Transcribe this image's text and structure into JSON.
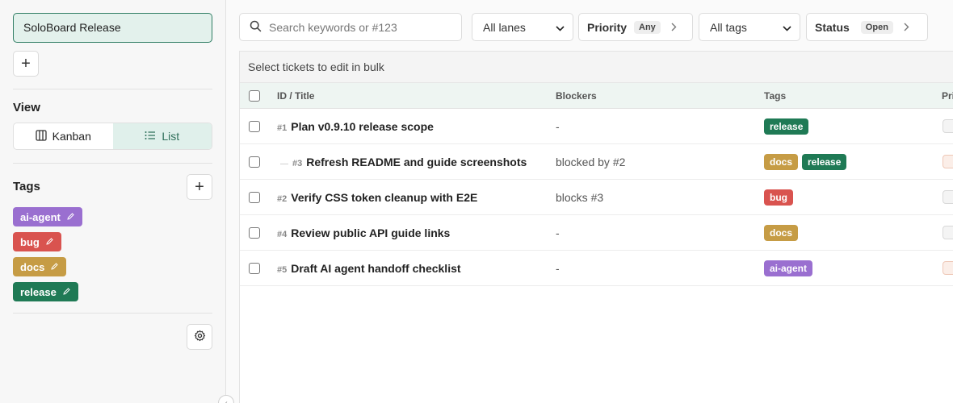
{
  "sidebar": {
    "board_name": "SoloBoard Release",
    "add_board_label": "+",
    "view_title": "View",
    "views": [
      {
        "label": "Kanban",
        "icon": "kanban-icon",
        "active": false
      },
      {
        "label": "List",
        "icon": "list-icon",
        "active": true
      }
    ],
    "tags_title": "Tags",
    "add_tag_label": "+",
    "tags": [
      {
        "label": "ai-agent",
        "color": "#9a6fd0"
      },
      {
        "label": "bug",
        "color": "#d9534f"
      },
      {
        "label": "docs",
        "color": "#c69c45"
      },
      {
        "label": "release",
        "color": "#1f7a55"
      }
    ],
    "settings_icon": "gear-icon"
  },
  "toolbar": {
    "search_placeholder": "Search keywords or #123",
    "lane_select": "All lanes",
    "priority_label": "Priority",
    "priority_value": "Any",
    "tags_select": "All tags",
    "status_label": "Status",
    "status_value": "Open"
  },
  "table": {
    "bulk_hint": "Select tickets to edit in bulk",
    "columns": {
      "id_title": "ID / Title",
      "blockers": "Blockers",
      "tags": "Tags",
      "priority": "Pri"
    },
    "rows": [
      {
        "id": "#1",
        "title": "Plan v0.9.10 release scope",
        "blockers": "-",
        "tags": [
          {
            "label": "release",
            "color": "#1f7a55"
          }
        ],
        "child": false,
        "priority_level": "normal"
      },
      {
        "id": "#3",
        "title": "Refresh README and guide screenshots",
        "blockers": "blocked by #2",
        "tags": [
          {
            "label": "docs",
            "color": "#c69c45"
          },
          {
            "label": "release",
            "color": "#1f7a55"
          }
        ],
        "child": true,
        "priority_level": "high"
      },
      {
        "id": "#2",
        "title": "Verify CSS token cleanup with E2E",
        "blockers": "blocks #3",
        "tags": [
          {
            "label": "bug",
            "color": "#d9534f"
          }
        ],
        "child": false,
        "priority_level": "normal"
      },
      {
        "id": "#4",
        "title": "Review public API guide links",
        "blockers": "-",
        "tags": [
          {
            "label": "docs",
            "color": "#c69c45"
          }
        ],
        "child": false,
        "priority_level": "normal"
      },
      {
        "id": "#5",
        "title": "Draft AI agent handoff checklist",
        "blockers": "-",
        "tags": [
          {
            "label": "ai-agent",
            "color": "#9a6fd0"
          }
        ],
        "child": false,
        "priority_level": "high"
      }
    ]
  }
}
